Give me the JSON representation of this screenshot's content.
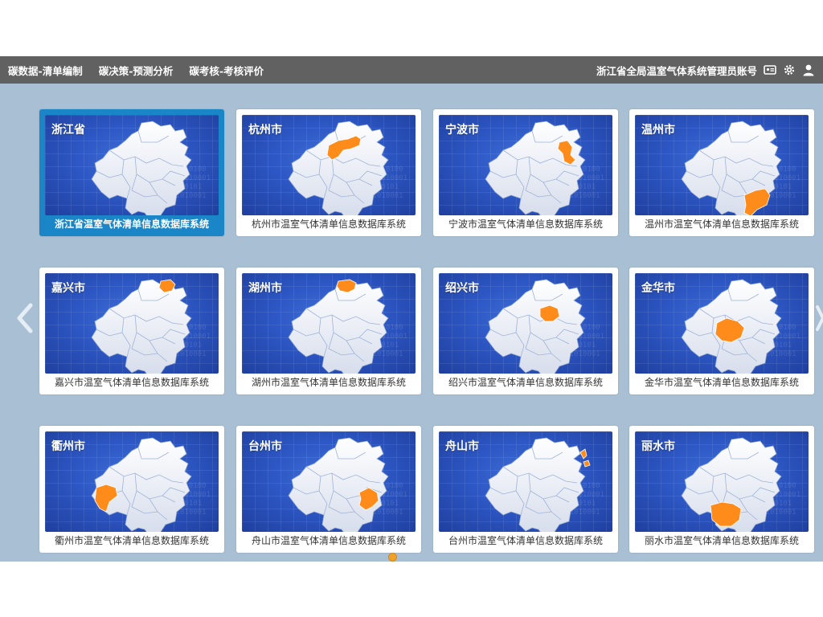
{
  "nav": {
    "items": [
      "碳数据-清单编制",
      "碳决策-预测分析",
      "碳考核-考核评价"
    ],
    "account": "浙江省全局温室气体系统管理员账号"
  },
  "colors": {
    "highlight": "#ff8c1a",
    "navbar": "#616161",
    "content_bg": "#a9c0d4",
    "active_card": "#1a86c8"
  },
  "cards": [
    {
      "name": "浙江省",
      "caption": "浙江省温室气体清单信息数据库系统",
      "region": "none",
      "active": true
    },
    {
      "name": "杭州市",
      "caption": "杭州市温室气体清单信息数据库系统",
      "region": "hangzhou"
    },
    {
      "name": "宁波市",
      "caption": "宁波市温室气体清单信息数据库系统",
      "region": "ningbo"
    },
    {
      "name": "温州市",
      "caption": "温州市温室气体清单信息数据库系统",
      "region": "wenzhou"
    },
    {
      "name": "嘉兴市",
      "caption": "嘉兴市温室气体清单信息数据库系统",
      "region": "jiaxing"
    },
    {
      "name": "湖州市",
      "caption": "湖州市温室气体清单信息数据库系统",
      "region": "huzhou"
    },
    {
      "name": "绍兴市",
      "caption": "绍兴市温室气体清单信息数据库系统",
      "region": "shaoxing"
    },
    {
      "name": "金华市",
      "caption": "金华市温室气体清单信息数据库系统",
      "region": "jinhua"
    },
    {
      "name": "衢州市",
      "caption": "衢州市温室气体清单信息数据库系统",
      "region": "quzhou"
    },
    {
      "name": "台州市",
      "caption": "舟山市温室气体清单信息数据库系统",
      "region": "taizhou"
    },
    {
      "name": "舟山市",
      "caption": "台州市温室气体清单信息数据库系统",
      "region": "zhoushan"
    },
    {
      "name": "丽水市",
      "caption": "丽水市温室气体清单信息数据库系统",
      "region": "lishui"
    }
  ],
  "pagination": {
    "pages": 1,
    "current": 1
  }
}
